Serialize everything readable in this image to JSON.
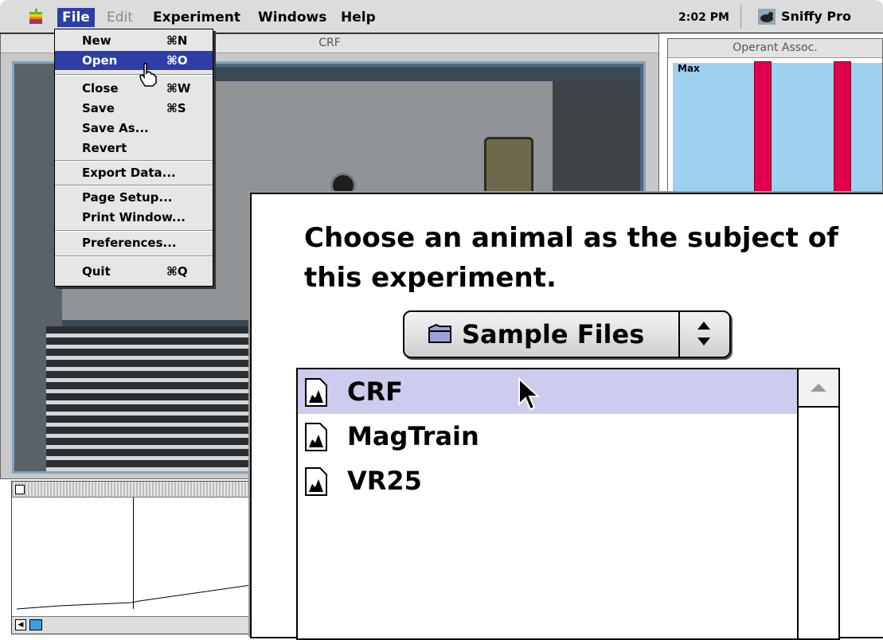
{
  "menubar": {
    "apple_icon": "apple-icon",
    "menus": [
      {
        "label": "File",
        "state": "active"
      },
      {
        "label": "Edit",
        "state": "disabled"
      },
      {
        "label": "Experiment",
        "state": "normal"
      },
      {
        "label": "Windows",
        "state": "normal"
      },
      {
        "label": "Help",
        "state": "normal"
      }
    ],
    "clock": "2:02 PM",
    "app_name": "Sniffy Pro",
    "app_icon": "sniffy-rat-icon"
  },
  "file_menu": {
    "items": [
      {
        "label": "New",
        "shortcut": "⌘N"
      },
      {
        "label": "Open",
        "shortcut": "⌘O",
        "selected": true
      },
      {
        "label": "Close",
        "shortcut": "⌘W"
      },
      {
        "label": "Save",
        "shortcut": "⌘S"
      },
      {
        "label": "Save As...",
        "shortcut": ""
      },
      {
        "label": "Revert",
        "shortcut": ""
      },
      {
        "label": "Export Data...",
        "shortcut": ""
      },
      {
        "label": "Page Setup...",
        "shortcut": ""
      },
      {
        "label": "Print Window...",
        "shortcut": ""
      },
      {
        "label": "Preferences...",
        "shortcut": ""
      },
      {
        "label": "Quit",
        "shortcut": "⌘Q"
      }
    ]
  },
  "crf_window": {
    "title": "CRF"
  },
  "assoc_window": {
    "title": "Operant Assoc.",
    "max_label": "Max",
    "bar_color": "#e0004f",
    "bg_color": "#9ed0f0"
  },
  "dialog": {
    "prompt": "Choose an animal as the subject of this experiment.",
    "folder": "Sample Files",
    "folder_icon": "folder-icon",
    "files": [
      {
        "name": "CRF",
        "selected": true
      },
      {
        "name": "MagTrain",
        "selected": false
      },
      {
        "name": "VR25",
        "selected": false
      }
    ]
  }
}
